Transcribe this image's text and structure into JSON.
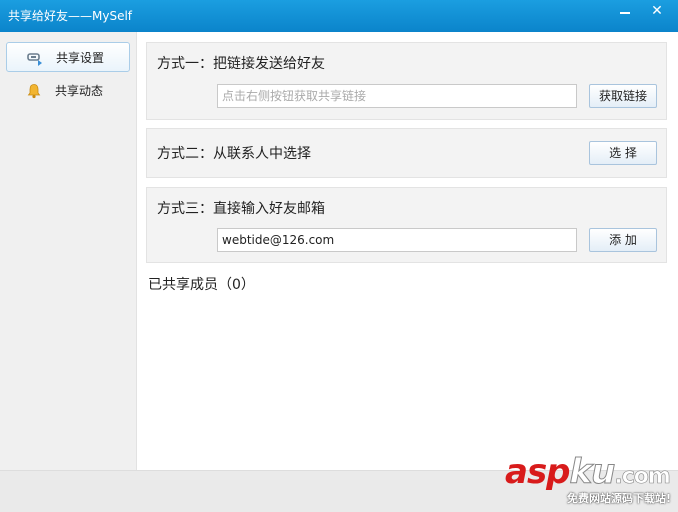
{
  "window": {
    "title": "共享给好友——MySelf",
    "minimize_icon": "minimize-icon",
    "close_symbol": "✕"
  },
  "sidebar": {
    "items": [
      {
        "label": "共享设置",
        "icon": "share-settings-icon",
        "active": true
      },
      {
        "label": "共享动态",
        "icon": "bell-icon",
        "active": false
      }
    ]
  },
  "methods": {
    "link": {
      "title": "方式一：把链接发送给好友",
      "input_value": "",
      "input_placeholder": "点击右侧按钮获取共享链接",
      "button_label": "获取链接"
    },
    "contacts": {
      "title": "方式二：从联系人中选择",
      "button_label": "选 择"
    },
    "email": {
      "title": "方式三：直接输入好友邮箱",
      "input_value": "webtide@126.com",
      "button_label": "添 加"
    }
  },
  "members": {
    "label": "已共享成员（0）"
  },
  "watermark": {
    "logo_asp": "asp",
    "logo_ku": "ku",
    "logo_com": ".com",
    "subtitle": "免费网站源码下载站!"
  },
  "colors": {
    "titlebar": "#1b9ee0",
    "panel_bg": "#f3f3f3",
    "sidebar_bg": "#f0f0f0",
    "watermark_red": "#d81b1b"
  }
}
